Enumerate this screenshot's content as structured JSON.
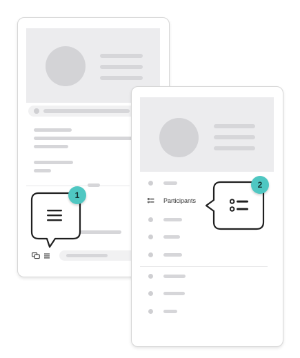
{
  "panel_two": {
    "participants_label": "Participants"
  },
  "callouts": [
    {
      "number": "1",
      "icon": "menu-icon"
    },
    {
      "number": "2",
      "icon": "list-icon"
    }
  ],
  "icons": {
    "chat_icon": "chat-icon",
    "menu_small_icon": "menu-icon",
    "participants_list_icon": "list-icon"
  },
  "colors": {
    "badge": "#4fc7c2",
    "placeholder": "#d6d6d9",
    "hero_background": "#ececee",
    "outline": "#1f1f1f"
  }
}
